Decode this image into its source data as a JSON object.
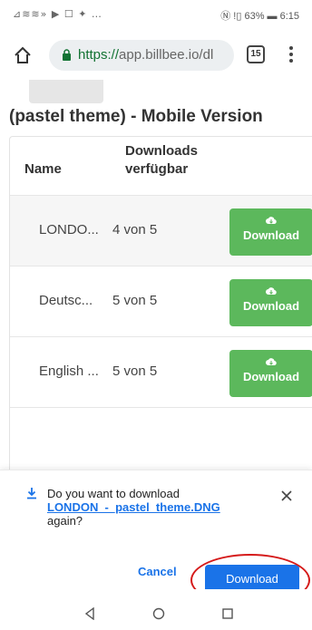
{
  "status": {
    "left_icons": "⊿≋≋» ▶ ☐ ✦ …",
    "right": "Ⓝ !▯ 63% ▬ 6:15"
  },
  "browser": {
    "url_scheme": "https://",
    "url_rest": "app.billbee.io/dl",
    "tab_count": "15"
  },
  "page": {
    "title": "(pastel theme) - Mobile Version",
    "columns": [
      "Name",
      "Downloads verfügbar"
    ],
    "rows": [
      {
        "name": "LONDO...",
        "count": "4 von 5",
        "button": "Download"
      },
      {
        "name": "Deutsc...",
        "count": "5 von 5",
        "button": "Download"
      },
      {
        "name": "English ...",
        "count": "5 von 5",
        "button": "Download"
      }
    ]
  },
  "dialog": {
    "prompt_before": "Do you want to download",
    "filename": "LONDON_-_pastel_theme.DNG",
    "prompt_after": "again?",
    "cancel_label": "Cancel",
    "download_label": "Download"
  },
  "colors": {
    "accent": "#1a73e8",
    "button_green": "#5cb85c",
    "annotation_red": "#d51a1a"
  }
}
